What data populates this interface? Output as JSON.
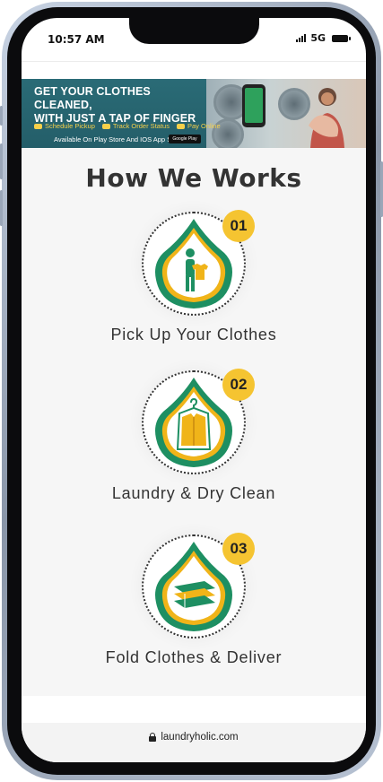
{
  "status_bar": {
    "time": "10:57 AM",
    "network": "5G"
  },
  "banner": {
    "title_line1": "GET YOUR CLOTHES CLEANED,",
    "title_line2": "WITH JUST A TAP OF FINGER",
    "features": [
      "Schedule Pickup",
      "Track Order Status",
      "Pay Online"
    ],
    "availability": "Available On Play Store And IOS App Store",
    "store_badge": "Google Play"
  },
  "section": {
    "heading": "How We Works"
  },
  "steps": [
    {
      "number": "01",
      "label": "Pick Up Your Clothes",
      "icon": "person-carrying-shirt-icon"
    },
    {
      "number": "02",
      "label": "Laundry & Dry Clean",
      "icon": "jacket-on-hanger-icon"
    },
    {
      "number": "03",
      "label": "Fold Clothes & Deliver",
      "icon": "folded-clothes-stack-icon"
    }
  ],
  "browser": {
    "url": "laundryholic.com"
  },
  "colors": {
    "accent_yellow": "#f5c431",
    "drop_green": "#1e8f62",
    "drop_gold": "#f0b419",
    "heading_text": "#333333"
  }
}
